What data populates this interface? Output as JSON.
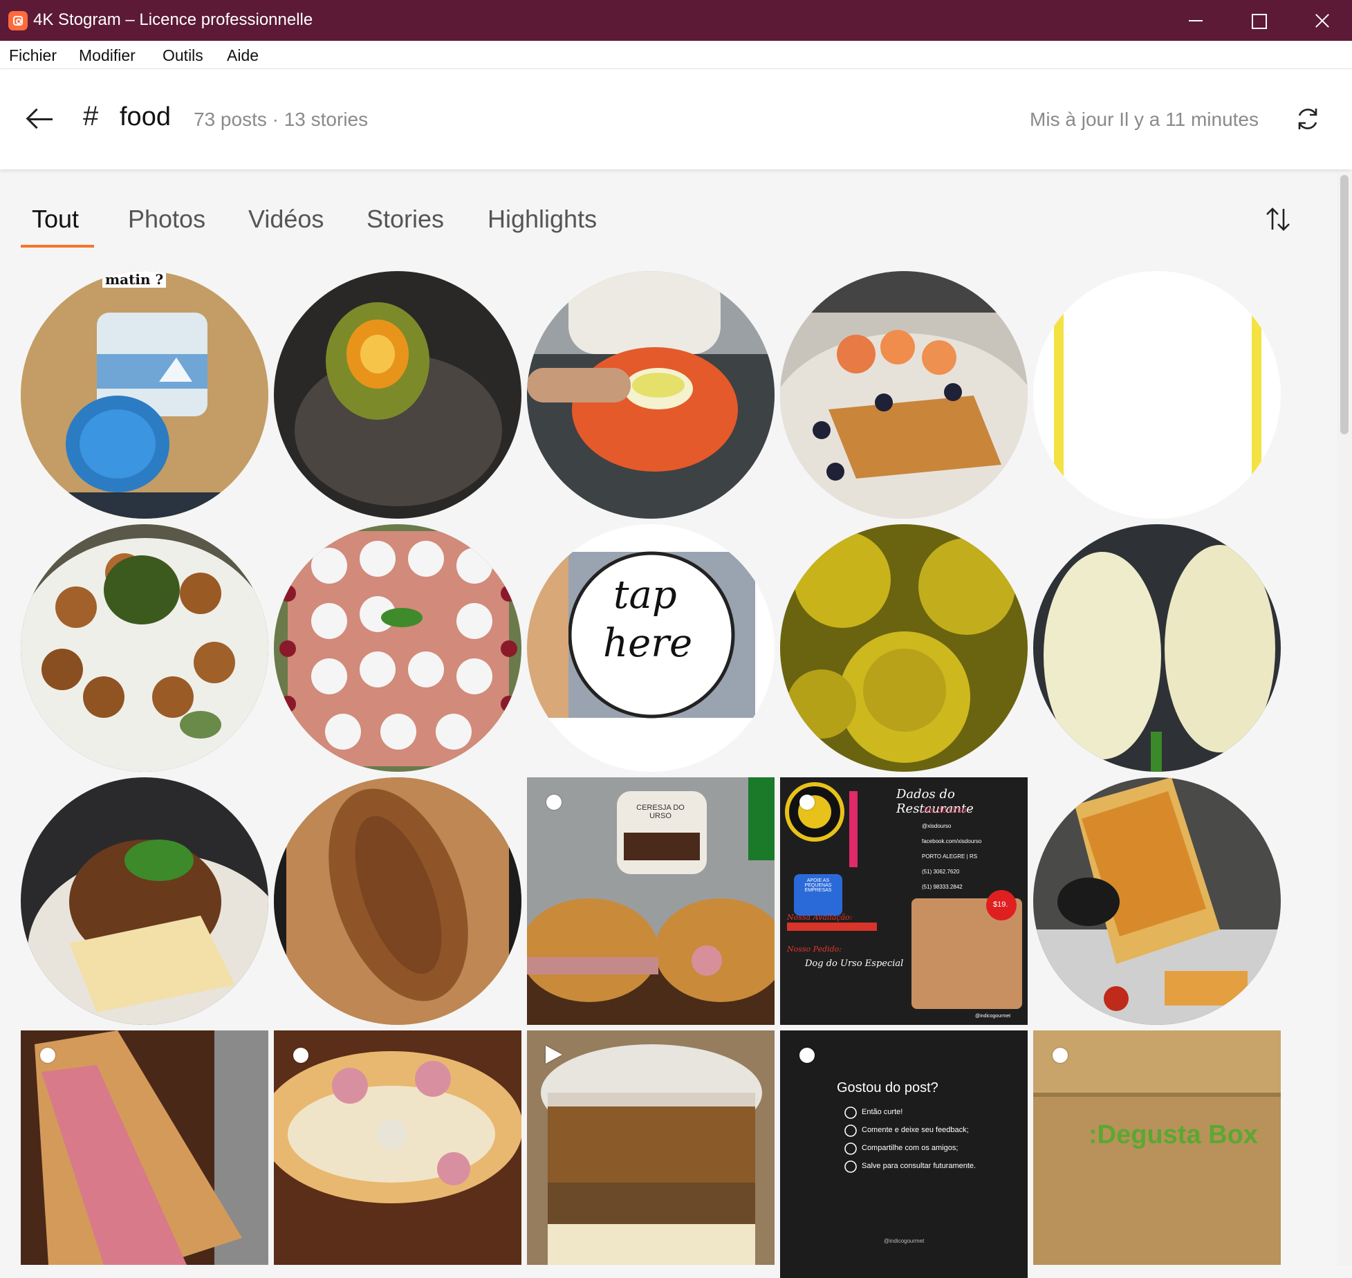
{
  "window": {
    "title": "4K Stogram – Licence professionnelle"
  },
  "menu": {
    "items": [
      "Fichier",
      "Modifier",
      "Outils",
      "Aide"
    ]
  },
  "header": {
    "hash": "#",
    "tag": "food",
    "counts": "73 posts · 13 stories",
    "updated": "Mis à jour Il y a 11 minutes"
  },
  "tabs": [
    "Tout",
    "Photos",
    "Vidéos",
    "Stories",
    "Highlights"
  ],
  "active_tab": "Tout",
  "colors": {
    "titlebar": "#5c1a36",
    "accent": "#f5752a",
    "app_icon": "#ff6a3d"
  },
  "grid": {
    "texts": {
      "matin": "matin ?",
      "tap": "tap",
      "here": "here",
      "dados_title": "Dados do Restaurante",
      "dados_sub": "- Xis do Urso -",
      "dados_lines": [
        "@xisdourso",
        "facebook.com/xisdourso",
        "PORTO ALEGRE | RS",
        "(51) 3062.7620",
        "(51) 98333.2842"
      ],
      "dados_price": "$19.",
      "dados_order": "Nosso Pedido:",
      "dados_dog": "Dog do Urso Especial",
      "dados_rating": "Nossa Avaliação:",
      "dados_badge": "APOIE AS PEQUENAS EMPRESAS",
      "dados_handle": "@indicogourmet",
      "gostou_title": "Gostou do post?",
      "gostou_items": [
        "Então curte!",
        "Comente e deixe seu feedback;",
        "Compartilhe com os amigos;",
        "Salve para consultar futuramente."
      ],
      "gostou_handle": "@indicogourmet",
      "degusta": ":Degusta Box",
      "comer": "CERESJA DO URSO"
    }
  }
}
